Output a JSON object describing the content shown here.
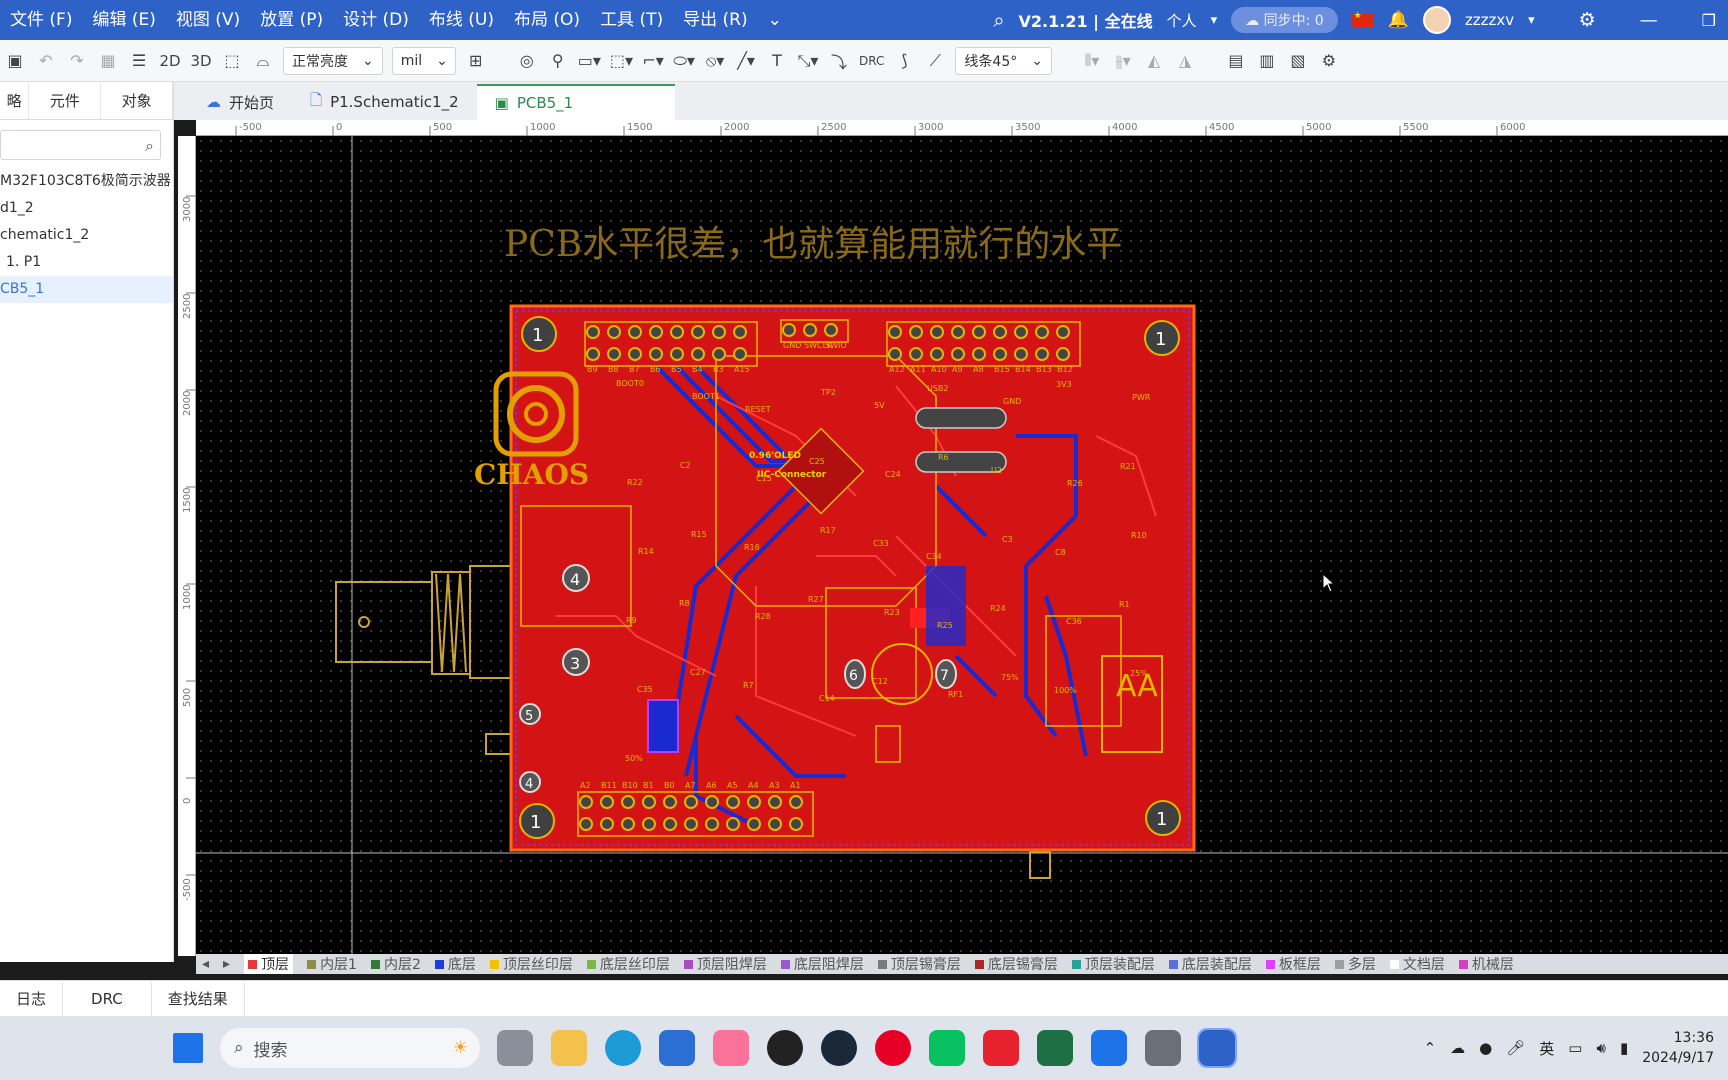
{
  "menubar": {
    "items": [
      "文件 (F)",
      "编辑 (E)",
      "视图 (V)",
      "放置 (P)",
      "设计 (D)",
      "布线 (U)",
      "布局 (O)",
      "工具 (T)",
      "导出 (R)"
    ],
    "version": "V2.1.21 | 全在线",
    "account_type": "个人",
    "sync_label": "同步中: 0",
    "username": "zzzzxv"
  },
  "toolbar": {
    "view_2d": "2D",
    "view_3d": "3D",
    "brightness": "正常亮度",
    "unit": "mil",
    "drc_label": "DRC",
    "route_mode": "线条45°"
  },
  "left_panel": {
    "tabs": [
      "略",
      "元件",
      "对象"
    ],
    "search_placeholder": "",
    "tree": [
      "M32F103C8T6极简示波器",
      "d1_2",
      "chematic1_2",
      "1. P1",
      "CB5_1"
    ]
  },
  "doc_tabs": [
    "开始页",
    "P1.Schematic1_2",
    "PCB5_1"
  ],
  "ruler": {
    "h_ticks": [
      "-500",
      "0",
      "500",
      "1000",
      "1500",
      "2000",
      "2500",
      "3000",
      "3500",
      "4000",
      "4500",
      "5000",
      "5500",
      "6000"
    ],
    "v_ticks": [
      "3000",
      "2500",
      "2000",
      "1500",
      "1000",
      "500",
      "0",
      "-500"
    ]
  },
  "canvas": {
    "note": "PCB水平很差，也就算能用就行的水平",
    "logo_text": "CHAOS",
    "oled_label": "0.96'OLED",
    "i2c_label": "IIC-Connector",
    "hole_numbers": [
      "1",
      "1",
      "1",
      "1"
    ],
    "pads": [
      "4",
      "3",
      "5",
      "4",
      "6",
      "7"
    ],
    "header_top_left_labels": [
      "B9",
      "B8",
      "B7",
      "B6",
      "B5",
      "B4",
      "B3",
      "A15"
    ],
    "header_top_right_labels": [
      "A12",
      "A11",
      "A10",
      "A9",
      "A8",
      "B15",
      "B14",
      "B13",
      "B12"
    ],
    "header_bottom_labels": [
      "A2",
      "B11",
      "B10",
      "B1",
      "B0",
      "A7",
      "A6",
      "A5",
      "A4",
      "A3",
      "A1"
    ],
    "swd_labels": [
      "GND",
      "SWCLK",
      "SWIO"
    ],
    "misc_labels": [
      "BOOT0",
      "BOOT1",
      "RESET",
      "TP2",
      "5V",
      "USB2",
      "GND",
      "3V3",
      "PWR",
      "R22",
      "C2",
      "C15",
      "C25",
      "C24",
      "R6",
      "U2",
      "R26",
      "R21",
      "R14",
      "R15",
      "R16",
      "R17",
      "C33",
      "C34",
      "C3",
      "C8",
      "R10",
      "R9",
      "R8",
      "R28",
      "R27",
      "R23",
      "R25",
      "R24",
      "C36",
      "R1",
      "C35",
      "C27",
      "R7",
      "C14",
      "C12",
      "RF1",
      "75%",
      "100%",
      "25%",
      "50%"
    ]
  },
  "layers": [
    {
      "name": "顶层",
      "color": "#e53935"
    },
    {
      "name": "内层1",
      "color": "#8d8d4a"
    },
    {
      "name": "内层2",
      "color": "#2e7d32"
    },
    {
      "name": "底层",
      "color": "#1e3cd8"
    },
    {
      "name": "顶层丝印层",
      "color": "#f2c200"
    },
    {
      "name": "底层丝印层",
      "color": "#7ab648"
    },
    {
      "name": "顶层阻焊层",
      "color": "#a64dbf"
    },
    {
      "name": "底层阻焊层",
      "color": "#9b59d0"
    },
    {
      "name": "顶层锡膏层",
      "color": "#7a7a7a"
    },
    {
      "name": "底层锡膏层",
      "color": "#a52a2a"
    },
    {
      "name": "顶层装配层",
      "color": "#2aa198"
    },
    {
      "name": "底层装配层",
      "color": "#5b6fd8"
    },
    {
      "name": "板框层",
      "color": "#e040fb"
    },
    {
      "name": "多层",
      "color": "#9e9e9e"
    },
    {
      "name": "文档层",
      "color": "#ffffff"
    },
    {
      "name": "机械层",
      "color": "#d63fbf"
    }
  ],
  "bottom_tabs": [
    "日志",
    "DRC",
    "查找结果"
  ],
  "taskbar": {
    "search_label": "搜索",
    "ime": "英",
    "time": "13:36",
    "date": "2024/9/17"
  },
  "colors": {
    "menubar": "#2f62c6",
    "board_fill": "#d41414",
    "silk": "#e2b600",
    "bottom_trace": "#1a2ad0",
    "top_trace": "#ff3a3a"
  }
}
